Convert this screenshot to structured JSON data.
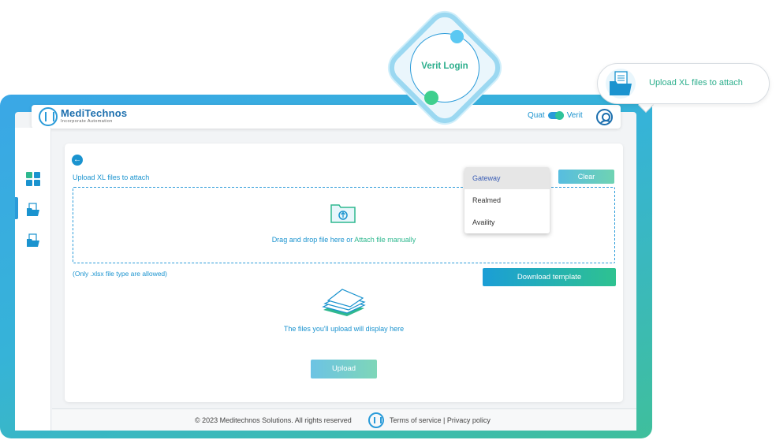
{
  "app": {
    "brand": "MediTechnos",
    "brand_tagline": "Incorporate Automation",
    "toggle_left": "Quat",
    "toggle_right": "Verit"
  },
  "overlay": {
    "verit_login": "Verit Login",
    "bubble_text": "Upload XL files to attach"
  },
  "main": {
    "back_icon": "←",
    "upload_label": "Upload XL files to attach",
    "clear_label": "Clear",
    "drag_prefix": "Drag and drop file here or ",
    "drag_link": "Attach file manually",
    "only_note": "(Only .xlsx file type are allowed)",
    "download_label": "Download template",
    "files_placeholder": "The files you'll upload will display here",
    "upload_label_btn": "Upload"
  },
  "dropdown": {
    "options": [
      "Gateway",
      "Realmed",
      "Availity"
    ],
    "selected": "Gateway"
  },
  "footer": {
    "copyright": "© 2023 Meditechnos Solutions. All rights reserved",
    "terms": "Terms of service",
    "separator": "|",
    "privacy": "Privacy policy"
  },
  "icons": {
    "sidebar": [
      "dashboard-icon",
      "folder-upload-icon",
      "folder-file-icon"
    ],
    "accent_blue": "#1a93cf",
    "accent_green": "#2fb88f"
  }
}
